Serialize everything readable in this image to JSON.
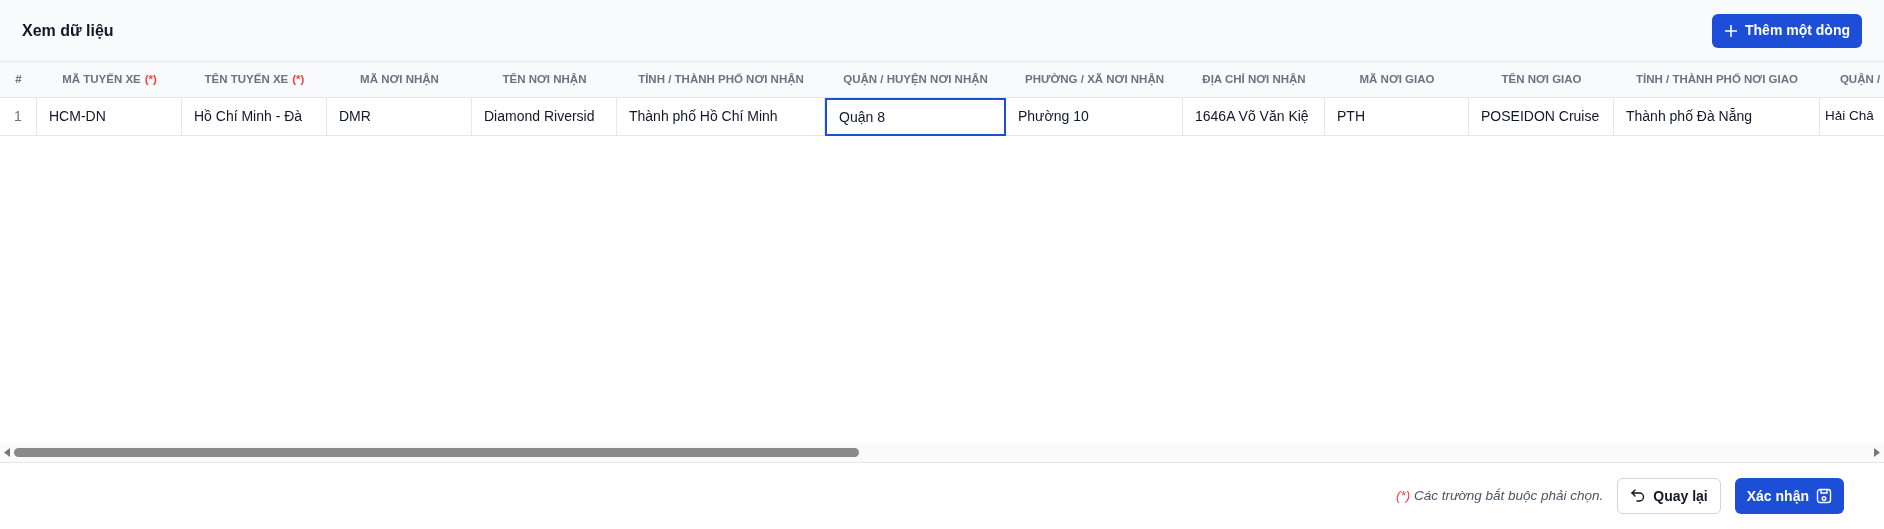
{
  "title": "Xem dữ liệu",
  "add_button": "Thêm một dòng",
  "table": {
    "columns": [
      {
        "label": "#"
      },
      {
        "label": "MÃ TUYẾN XE",
        "required_mark": "(*)"
      },
      {
        "label": "TÊN TUYẾN XE",
        "required_mark": "(*)"
      },
      {
        "label": "MÃ NƠI NHẬN"
      },
      {
        "label": "TÊN NƠI NHẬN"
      },
      {
        "label": "TỈNH / THÀNH PHỐ NƠI NHẬN"
      },
      {
        "label": "QUẬN / HUYỆN NƠI NHẬN"
      },
      {
        "label": "PHƯỜNG / XÃ NƠI NHẬN"
      },
      {
        "label": "ĐỊA CHỈ NƠI NHẬN"
      },
      {
        "label": "MÃ NƠI GIAO"
      },
      {
        "label": "TÊN NƠI GIAO"
      },
      {
        "label": "TỈNH / THÀNH PHỐ NƠI GIAO"
      },
      {
        "label": "QUẬN /"
      }
    ],
    "rows": [
      {
        "cells": [
          {
            "text": "1",
            "selected": false
          },
          {
            "text": "HCM-DN",
            "selected": false
          },
          {
            "text": "Hồ Chí Minh - Đà",
            "selected": false
          },
          {
            "text": "DMR",
            "selected": false
          },
          {
            "text": "Diamond Riversid",
            "selected": false
          },
          {
            "text": "Thành phố Hồ Chí Minh",
            "selected": false
          },
          {
            "text": "Quận 8",
            "selected": true
          },
          {
            "text": "Phường 10",
            "selected": false
          },
          {
            "text": "1646A Võ Văn Kiệ",
            "selected": false
          },
          {
            "text": "PTH",
            "selected": false
          },
          {
            "text": "POSEIDON Cruise",
            "selected": false
          },
          {
            "text": "Thành phố Đà Nẵng",
            "selected": false
          },
          {
            "text": "Hải Châ",
            "selected": false
          }
        ]
      }
    ]
  },
  "footer": {
    "note_mark": "(*)",
    "note": "Các trường bắt buộc phải chọn.",
    "back_button": "Quay lại",
    "confirm_button": "Xác nhận"
  }
}
